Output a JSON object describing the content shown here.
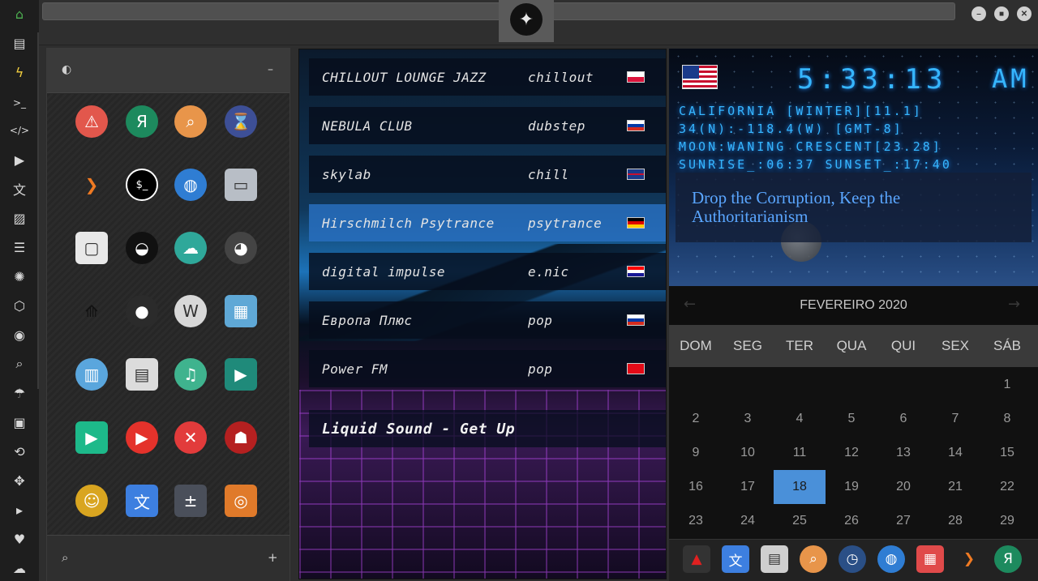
{
  "left_bar": {
    "icons": [
      "home-icon",
      "document-icon",
      "bolt-icon",
      "terminal-icon",
      "code-icon",
      "play-icon",
      "translate-icon",
      "image-icon",
      "news-icon",
      "settings-wheel-icon",
      "hexagon-icon",
      "globe-icon",
      "search-icon",
      "umbrella-icon",
      "contact-icon",
      "link-icon",
      "expand-icon",
      "youtube-icon",
      "heart-icon",
      "cloud-icon"
    ],
    "glyphs": [
      "⌂",
      "▤",
      "ϟ",
      ">_",
      "</>",
      "▶",
      "文",
      "▨",
      "☰",
      "✺",
      "⬡",
      "◉",
      "⌕",
      "☂",
      "▣",
      "⟲",
      "✥",
      "▸",
      "♥",
      "☁"
    ]
  },
  "top_strip": {
    "logo_glyph": "✦",
    "window_buttons": [
      "–",
      "■",
      "✕"
    ]
  },
  "app_panel": {
    "header_left_glyph": "◐",
    "header_right_glyph": "–",
    "footer_left_glyph": "⌕",
    "footer_right_glyph": "+",
    "apps": [
      {
        "name": "warning-app-icon",
        "glyph": "⚠",
        "bg": "#e2574c"
      },
      {
        "name": "yandex-app-icon",
        "glyph": "Я",
        "bg": "#1d8a5e"
      },
      {
        "name": "search-app-icon",
        "glyph": "⌕",
        "bg": "#e8954a"
      },
      {
        "name": "hourglass-app-icon",
        "glyph": "⌛",
        "bg": "#3d4f96"
      },
      {
        "name": "chevron-app-icon",
        "glyph": "❯",
        "bg": "transparent"
      },
      {
        "name": "terminal-app-icon",
        "glyph": "$_",
        "bg": "#000000"
      },
      {
        "name": "globe-app-icon",
        "glyph": "◍",
        "bg": "#2f7dd3"
      },
      {
        "name": "scanner-app-icon",
        "glyph": "▭",
        "bg": "#b8bec6"
      },
      {
        "name": "window-app-icon",
        "glyph": "▢",
        "bg": "#e8e8e8"
      },
      {
        "name": "mouth-app-icon",
        "glyph": "◒",
        "bg": "#111111"
      },
      {
        "name": "cloud-lock-app-icon",
        "glyph": "☁",
        "bg": "#2fa89a"
      },
      {
        "name": "github-app-icon",
        "glyph": "◕",
        "bg": "#444444"
      },
      {
        "name": "starfleet-app-icon",
        "glyph": "⟰",
        "bg": "transparent"
      },
      {
        "name": "death-star-app-icon",
        "glyph": "●",
        "bg": "#2b2b2b"
      },
      {
        "name": "wikipedia-app-icon",
        "glyph": "W",
        "bg": "#d8d8d8"
      },
      {
        "name": "world-map-app-icon",
        "glyph": "▦",
        "bg": "#5fa8d6"
      },
      {
        "name": "books-app-icon",
        "glyph": "▥",
        "bg": "#5aa6dd"
      },
      {
        "name": "notes-app-icon",
        "glyph": "▤",
        "bg": "#dcdcdc"
      },
      {
        "name": "music-app-icon",
        "glyph": "♫",
        "bg": "#3fb38e"
      },
      {
        "name": "video-app-icon",
        "glyph": "▶",
        "bg": "#1f8a7a"
      },
      {
        "name": "player-app-icon",
        "glyph": "▶",
        "bg": "#1db98a"
      },
      {
        "name": "youtube-app-icon",
        "glyph": "▶",
        "bg": "#e4322b"
      },
      {
        "name": "close-app-icon",
        "glyph": "✕",
        "bg": "#e23b3b"
      },
      {
        "name": "ironman-app-icon",
        "glyph": "☗",
        "bg": "#b52020"
      },
      {
        "name": "c3po-app-icon",
        "glyph": "☺",
        "bg": "#d9a520"
      },
      {
        "name": "translate-app-icon",
        "glyph": "文",
        "bg": "#3d7fe0"
      },
      {
        "name": "calculator-app-icon",
        "glyph": "±",
        "bg": "#4a4f5a"
      },
      {
        "name": "camera-app-icon",
        "glyph": "◎",
        "bg": "#e07a2a"
      }
    ]
  },
  "radio": {
    "stations": [
      {
        "name": "CHILLOUT LOUNGE JAZZ",
        "genre": "chillout",
        "flag": "flag-poland",
        "flag_bg": "linear-gradient(180deg,#fff 50%,#dc143c 50%)",
        "active": false
      },
      {
        "name": "NEBULA CLUB",
        "genre": "dubstep",
        "flag": "flag-russia",
        "flag_bg": "linear-gradient(180deg,#fff 33%,#0039a6 33% 66%,#d52b1e 66%)",
        "active": false
      },
      {
        "name": "skylab",
        "genre": "chill",
        "flag": "flag-uk",
        "flag_bg": "linear-gradient(180deg,#1a3a8a 40%,#c8102e 40% 60%,#1a3a8a 60%)",
        "active": false
      },
      {
        "name": "Hirschmilch Psytrance",
        "genre": "psytrance",
        "flag": "flag-germany",
        "flag_bg": "linear-gradient(180deg,#000 33%,#dd0000 33% 66%,#ffce00 66%)",
        "active": true
      },
      {
        "name": "digital impulse",
        "genre": "e.nic",
        "flag": "flag-croatia",
        "flag_bg": "linear-gradient(180deg,#ff0000 33%,#fff 33% 66%,#171796 66%)",
        "active": false
      },
      {
        "name": "Европа Плюс",
        "genre": "pop",
        "flag": "flag-russia",
        "flag_bg": "linear-gradient(180deg,#fff 33%,#0039a6 33% 66%,#d52b1e 66%)",
        "active": false
      },
      {
        "name": "Power FM",
        "genre": "pop",
        "flag": "flag-turkey",
        "flag_bg": "#e30a17",
        "active": false
      }
    ],
    "now_playing": "Liquid Sound - Get Up"
  },
  "clock": {
    "time": "5:33:13",
    "ampm": "AM",
    "lines": [
      "CALIFORNIA [WINTER][11.1]",
      "34(N):-118.4(W) [GMT-8]",
      "MOON:WANING CRESCENT[23.28]",
      "SUNRISE_:06:37 SUNSET_:17:40"
    ],
    "quote": "Drop the Corruption, Keep the Authoritarianism",
    "lcd_color": "#36b6ff"
  },
  "calendar": {
    "month": "FEVEREIRO 2020",
    "prev_glyph": "←",
    "next_glyph": "→",
    "weekdays": [
      "DOM",
      "SEG",
      "TER",
      "QUA",
      "QUI",
      "SEX",
      "SÁB"
    ],
    "rows": [
      [
        "",
        "",
        "",
        "",
        "",
        "",
        "1"
      ],
      [
        "2",
        "3",
        "4",
        "5",
        "6",
        "7",
        "8"
      ],
      [
        "9",
        "10",
        "11",
        "12",
        "13",
        "14",
        "15"
      ],
      [
        "16",
        "17",
        "18",
        "19",
        "20",
        "21",
        "22"
      ],
      [
        "23",
        "24",
        "25",
        "26",
        "27",
        "28",
        "29"
      ]
    ],
    "today": "18",
    "today_color": "#4a90d9"
  },
  "dock": {
    "icons": [
      {
        "name": "red-a-dock-icon",
        "glyph": "▲",
        "bg": "#333333"
      },
      {
        "name": "translate-dock-icon",
        "glyph": "文",
        "bg": "#3d7fe0"
      },
      {
        "name": "news-dock-icon",
        "glyph": "▤",
        "bg": "#cfcfcf"
      },
      {
        "name": "search-dock-icon",
        "glyph": "⌕",
        "bg": "#e8954a"
      },
      {
        "name": "clock-dock-icon",
        "glyph": "◷",
        "bg": "#2a4f86"
      },
      {
        "name": "globe-dock-icon",
        "glyph": "◍",
        "bg": "#2f7dd3"
      },
      {
        "name": "calendar-dock-icon",
        "glyph": "▦",
        "bg": "#e04a4a"
      },
      {
        "name": "chevron-dock-icon",
        "glyph": "❯",
        "bg": "transparent"
      },
      {
        "name": "yandex-dock-icon",
        "glyph": "Я",
        "bg": "#1d8a5e"
      }
    ]
  }
}
